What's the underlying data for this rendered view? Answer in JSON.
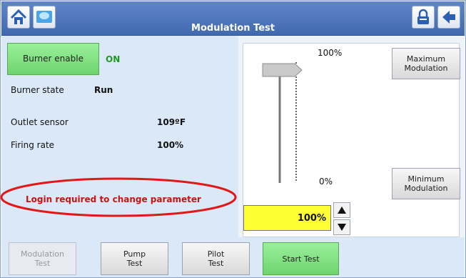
{
  "header": {
    "title": "Modulation Test",
    "home_icon": "home-icon",
    "display_icon": "display-icon",
    "lock_icon": "lock-icon",
    "back_icon": "back-arrow-icon"
  },
  "status": {
    "burner_enable_label": "Burner enable",
    "burner_enable_value": "ON",
    "burner_state_label": "Burner state",
    "burner_state_value": "Run",
    "outlet_sensor_label": "Outlet sensor",
    "outlet_sensor_value": "109ºF",
    "firing_rate_label": "Firing rate",
    "firing_rate_value": "100%",
    "login_message": "Login required to change parameter"
  },
  "modulation": {
    "max_label": "100%",
    "min_label": "0%",
    "max_button": "Maximum\nModulation",
    "min_button": "Minimum\nModulation",
    "value": "100%",
    "level_fraction": 1.0
  },
  "bottom_tabs": [
    {
      "label": "Modulation\nTest"
    },
    {
      "label": "Pump\nTest"
    },
    {
      "label": "Pilot\nTest"
    },
    {
      "label": "Start Test"
    }
  ],
  "colors": {
    "header": "#4a74b8",
    "on_green": "#1f9a1f",
    "alert_red": "#d01010",
    "value_yellow": "#ffff33",
    "button_green": "#7cdc7c"
  }
}
